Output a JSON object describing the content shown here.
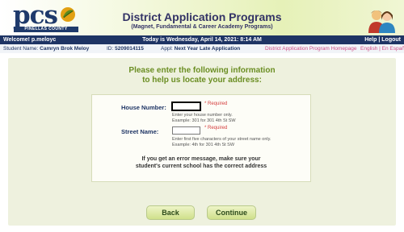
{
  "header": {
    "logo_text": "pcs",
    "logo_subtext": "PINELLAS COUNTY SCHOOLS",
    "title": "District Application Programs",
    "subtitle": "(Magnet, Fundamental & Career Academy Programs)"
  },
  "topbar": {
    "welcome": "Welcome! p.meloyc",
    "date": "Today is Wednesday, April 14, 2021: 8:14 AM",
    "help": "Help",
    "separator": "|",
    "logout": "Logout"
  },
  "infobar": {
    "student_label": "Student Name:",
    "student_name": "Camryn Brok Meloy",
    "id_label": "ID:",
    "id_value": "5209014115",
    "appl_label": "Appl:",
    "appl_value": "Next Year Late Application",
    "homepage_link": "District Application Program Homepage",
    "lang_links": "English | En Español"
  },
  "main": {
    "instructions_line1": "Please enter the following information",
    "instructions_line2": "to help us locate your address:",
    "house_label": "House Number:",
    "house_value": "",
    "house_required": "* Required",
    "house_hint1": "Enter your house number only.",
    "house_hint2": "Example: 301 for 301 4th St SW",
    "street_label": "Street Name:",
    "street_value": "",
    "street_required": "* Required",
    "street_hint1": "Enter first five characters of your street name only.",
    "street_hint2": "Example: 4th for 301 4th St SW",
    "error_line1": "If you get an error message, make sure your",
    "error_line2": "student's current school has the correct address"
  },
  "buttons": {
    "back": "Back",
    "continue": "Continue"
  },
  "colors": {
    "navy": "#1e3464",
    "accent_green": "#6b8e23",
    "required_red": "#d43c3c",
    "link_pink": "#d04d86"
  }
}
